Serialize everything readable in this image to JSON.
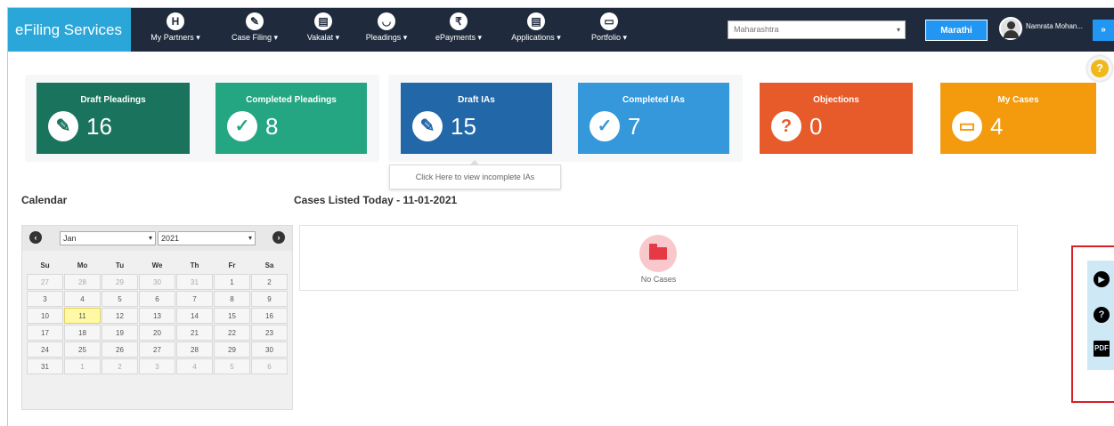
{
  "brand": "eFiling Services",
  "nav": [
    {
      "label": "My Partners ▾",
      "icon": "handshake-icon",
      "glyph": "H"
    },
    {
      "label": "Case Filing ▾",
      "icon": "pencil-icon",
      "glyph": "✎"
    },
    {
      "label": "Vakalat ▾",
      "icon": "file-icon",
      "glyph": "▤"
    },
    {
      "label": "Pleadings ▾",
      "icon": "book-icon",
      "glyph": "◡"
    },
    {
      "label": "ePayments ▾",
      "icon": "rupee-icon",
      "glyph": "₹"
    },
    {
      "label": "Applications ▾",
      "icon": "document-icon",
      "glyph": "▤"
    },
    {
      "label": "Portfolio ▾",
      "icon": "briefcase-icon",
      "glyph": "▭"
    }
  ],
  "state_select": {
    "value": "Maharashtra"
  },
  "language_button": "Marathi",
  "user_name": "Namrata Mohan...",
  "nav_toggle_glyph": "»",
  "help_glyph": "?",
  "cards": [
    {
      "title": "Draft Pleadings",
      "value": "16",
      "icon": "edit-icon",
      "glyph": "✎",
      "color": "#19735d"
    },
    {
      "title": "Completed Pleadings",
      "value": "8",
      "icon": "check-icon",
      "glyph": "✓",
      "color": "#24a683"
    },
    {
      "title": "Draft IAs",
      "value": "15",
      "icon": "edit-icon",
      "glyph": "✎",
      "color": "#2268a8"
    },
    {
      "title": "Completed IAs",
      "value": "7",
      "icon": "check-icon",
      "glyph": "✓",
      "color": "#3498db"
    },
    {
      "title": "Objections",
      "value": "0",
      "icon": "question-icon",
      "glyph": "?",
      "color": "#e75a2a"
    },
    {
      "title": "My Cases",
      "value": "4",
      "icon": "briefcase-icon",
      "glyph": "▭",
      "color": "#f39a0d"
    }
  ],
  "tooltip": "Click Here to view incomplete IAs",
  "calendar": {
    "title": "Calendar",
    "month": "Jan",
    "year": "2021",
    "weekdays": [
      "Su",
      "Mo",
      "Tu",
      "We",
      "Th",
      "Fr",
      "Sa"
    ],
    "weeks": [
      [
        "27",
        "28",
        "29",
        "30",
        "31",
        "1",
        "2"
      ],
      [
        "3",
        "4",
        "5",
        "6",
        "7",
        "8",
        "9"
      ],
      [
        "10",
        "11",
        "12",
        "13",
        "14",
        "15",
        "16"
      ],
      [
        "17",
        "18",
        "19",
        "20",
        "21",
        "22",
        "23"
      ],
      [
        "24",
        "25",
        "26",
        "27",
        "28",
        "29",
        "30"
      ],
      [
        "31",
        "1",
        "2",
        "3",
        "4",
        "5",
        "6"
      ]
    ],
    "today": "11"
  },
  "cases": {
    "title": "Cases Listed Today - 11-01-2021",
    "empty_text": "No Cases"
  },
  "side_tools": [
    {
      "icon": "play-icon",
      "glyph": "▶"
    },
    {
      "icon": "help-icon",
      "glyph": "?"
    },
    {
      "icon": "pdf-icon",
      "glyph": "PDF"
    }
  ]
}
